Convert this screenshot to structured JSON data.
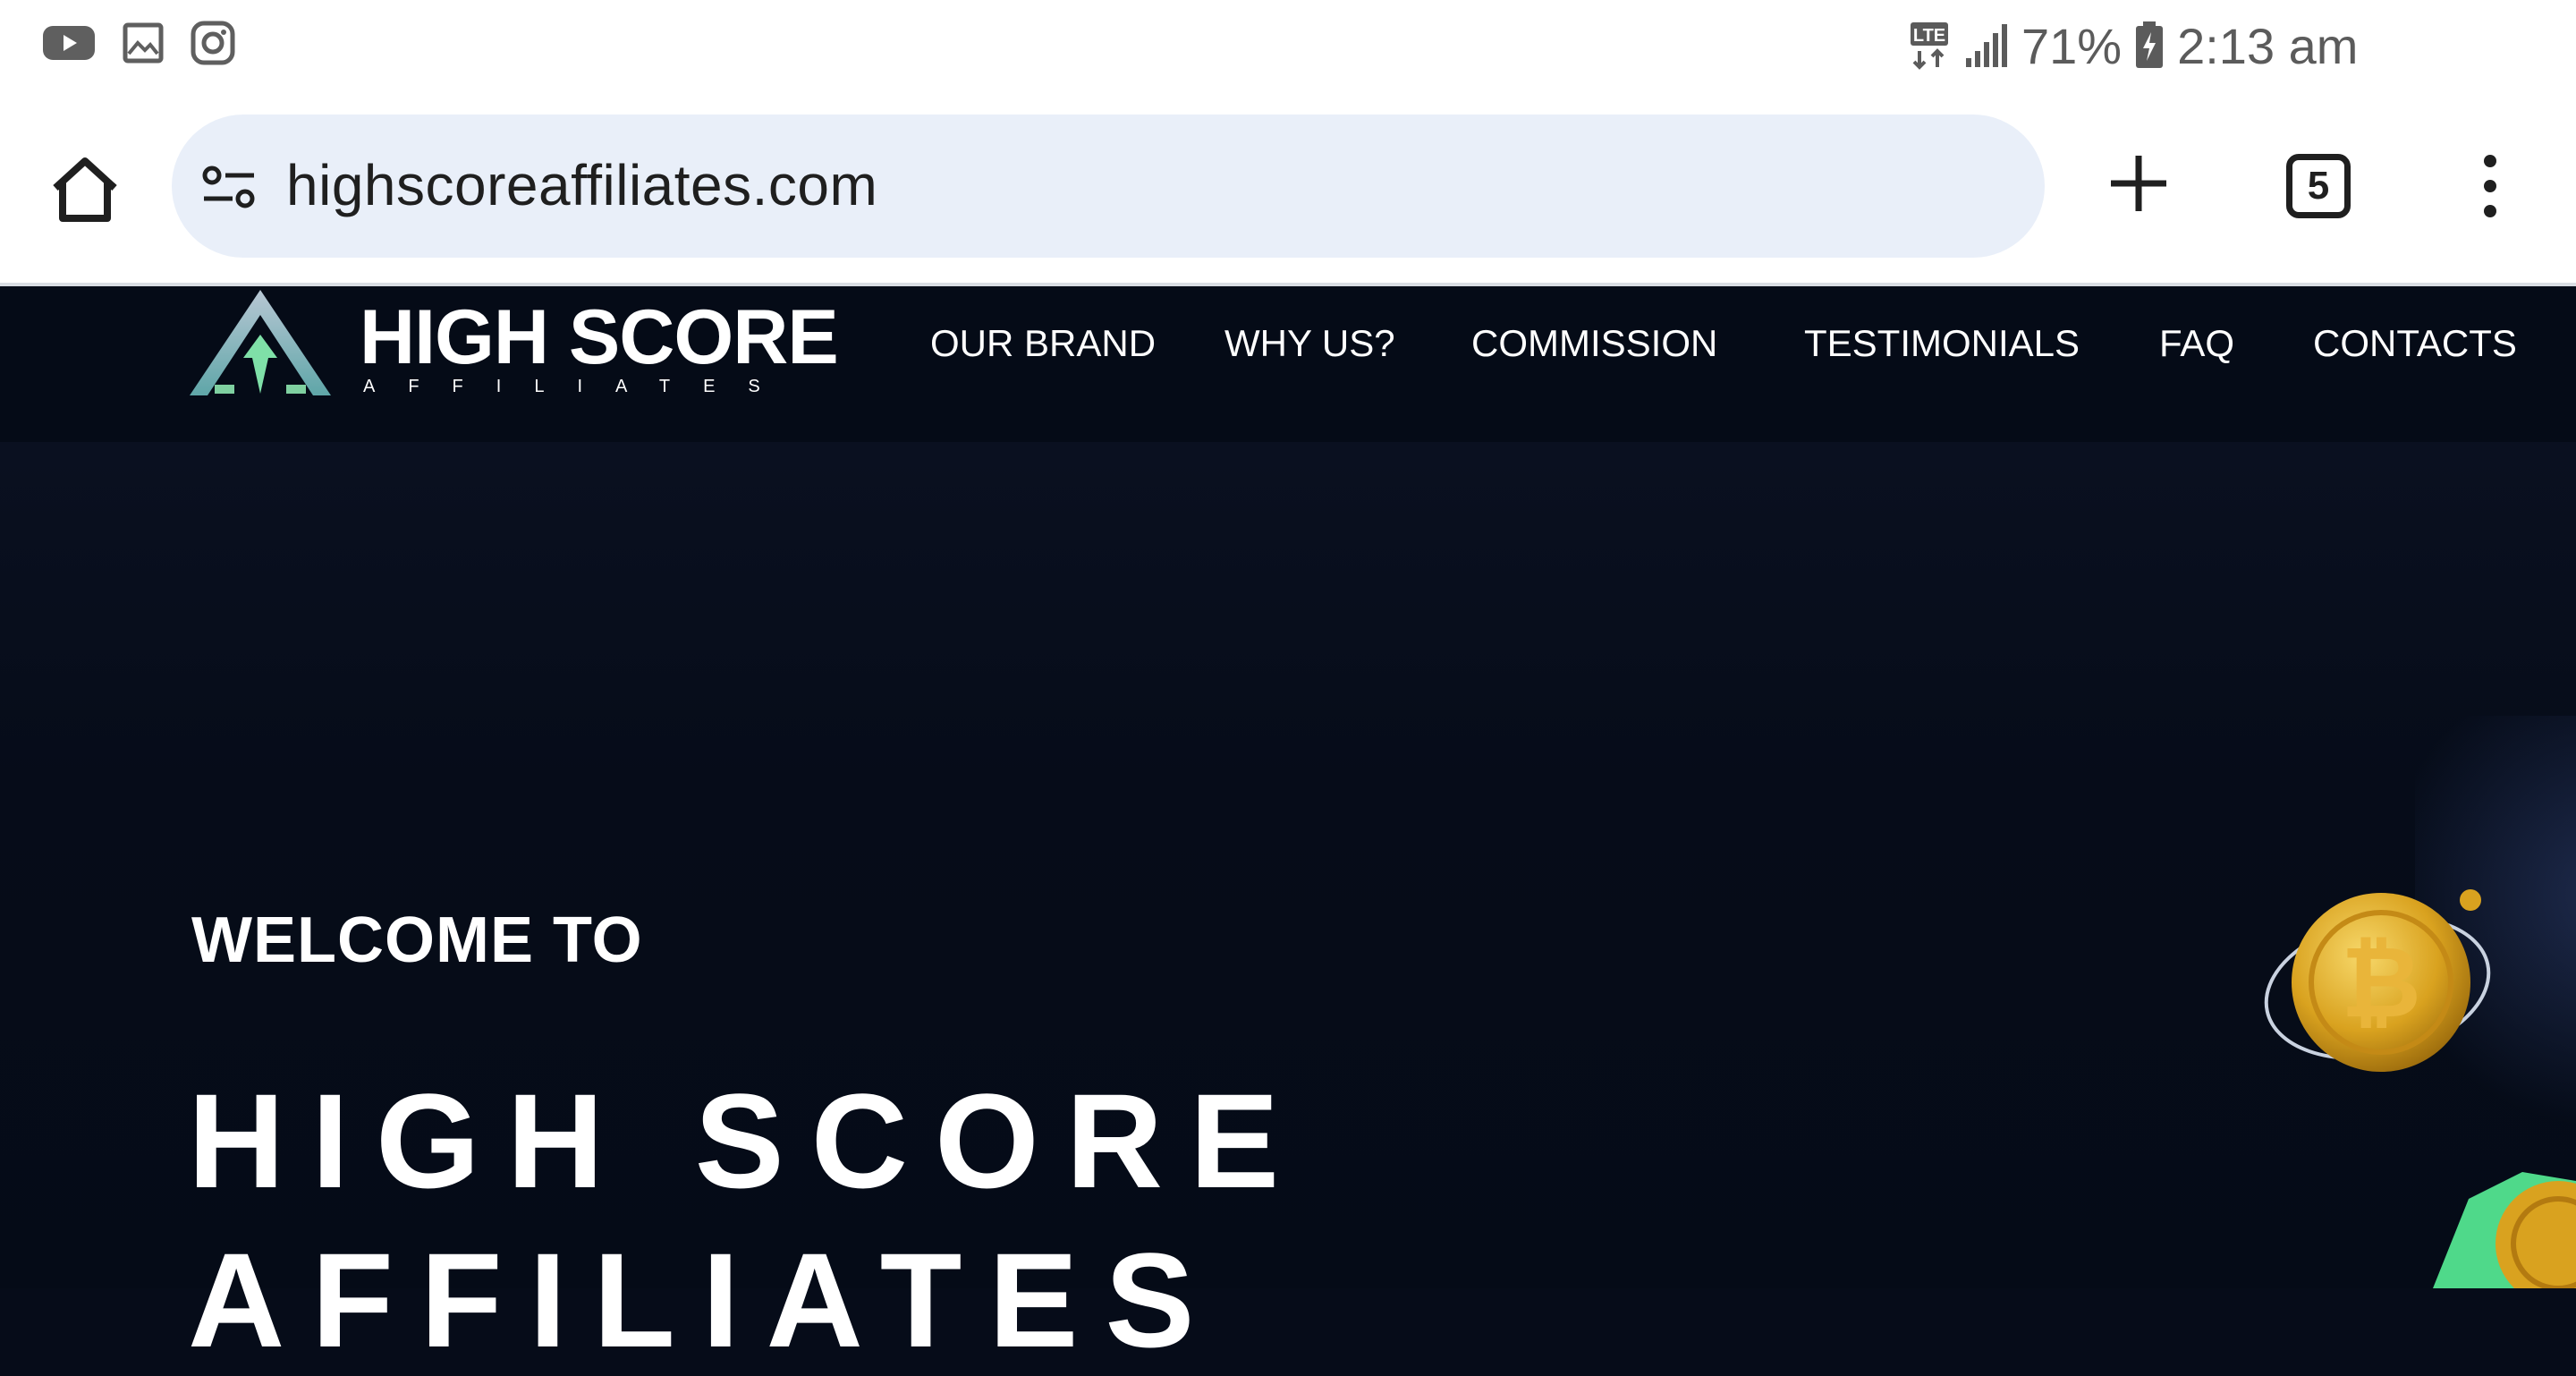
{
  "status_bar": {
    "notification_icons": [
      "youtube-icon",
      "gallery-icon",
      "instagram-icon"
    ],
    "network": "LTE",
    "battery_percent": "71%",
    "time": "2:13 am"
  },
  "browser": {
    "url": "highscoreaffiliates.com",
    "tab_count": "5",
    "icons": [
      "home-icon",
      "site-info-icon",
      "new-tab-icon",
      "tabs-icon",
      "more-menu-icon"
    ]
  },
  "site": {
    "logo_title": "HIGH SCORE",
    "logo_subtitle": "AFFILIATES",
    "nav": [
      {
        "label": "OUR BRAND"
      },
      {
        "label": "WHY US?"
      },
      {
        "label": "COMMISSION"
      },
      {
        "label": "TESTIMONIALS"
      },
      {
        "label": "FAQ"
      },
      {
        "label": "CONTACTS"
      }
    ],
    "hero": {
      "welcome": "WELCOME TO",
      "title_line1": "HIGH SCORE",
      "title_line2": "AFFILIATES"
    }
  },
  "colors": {
    "page_bg": "#060c19",
    "header_bg": "#050b17",
    "omnibox_bg": "#e9eff9",
    "logo_accent": "#7fe0a8"
  }
}
